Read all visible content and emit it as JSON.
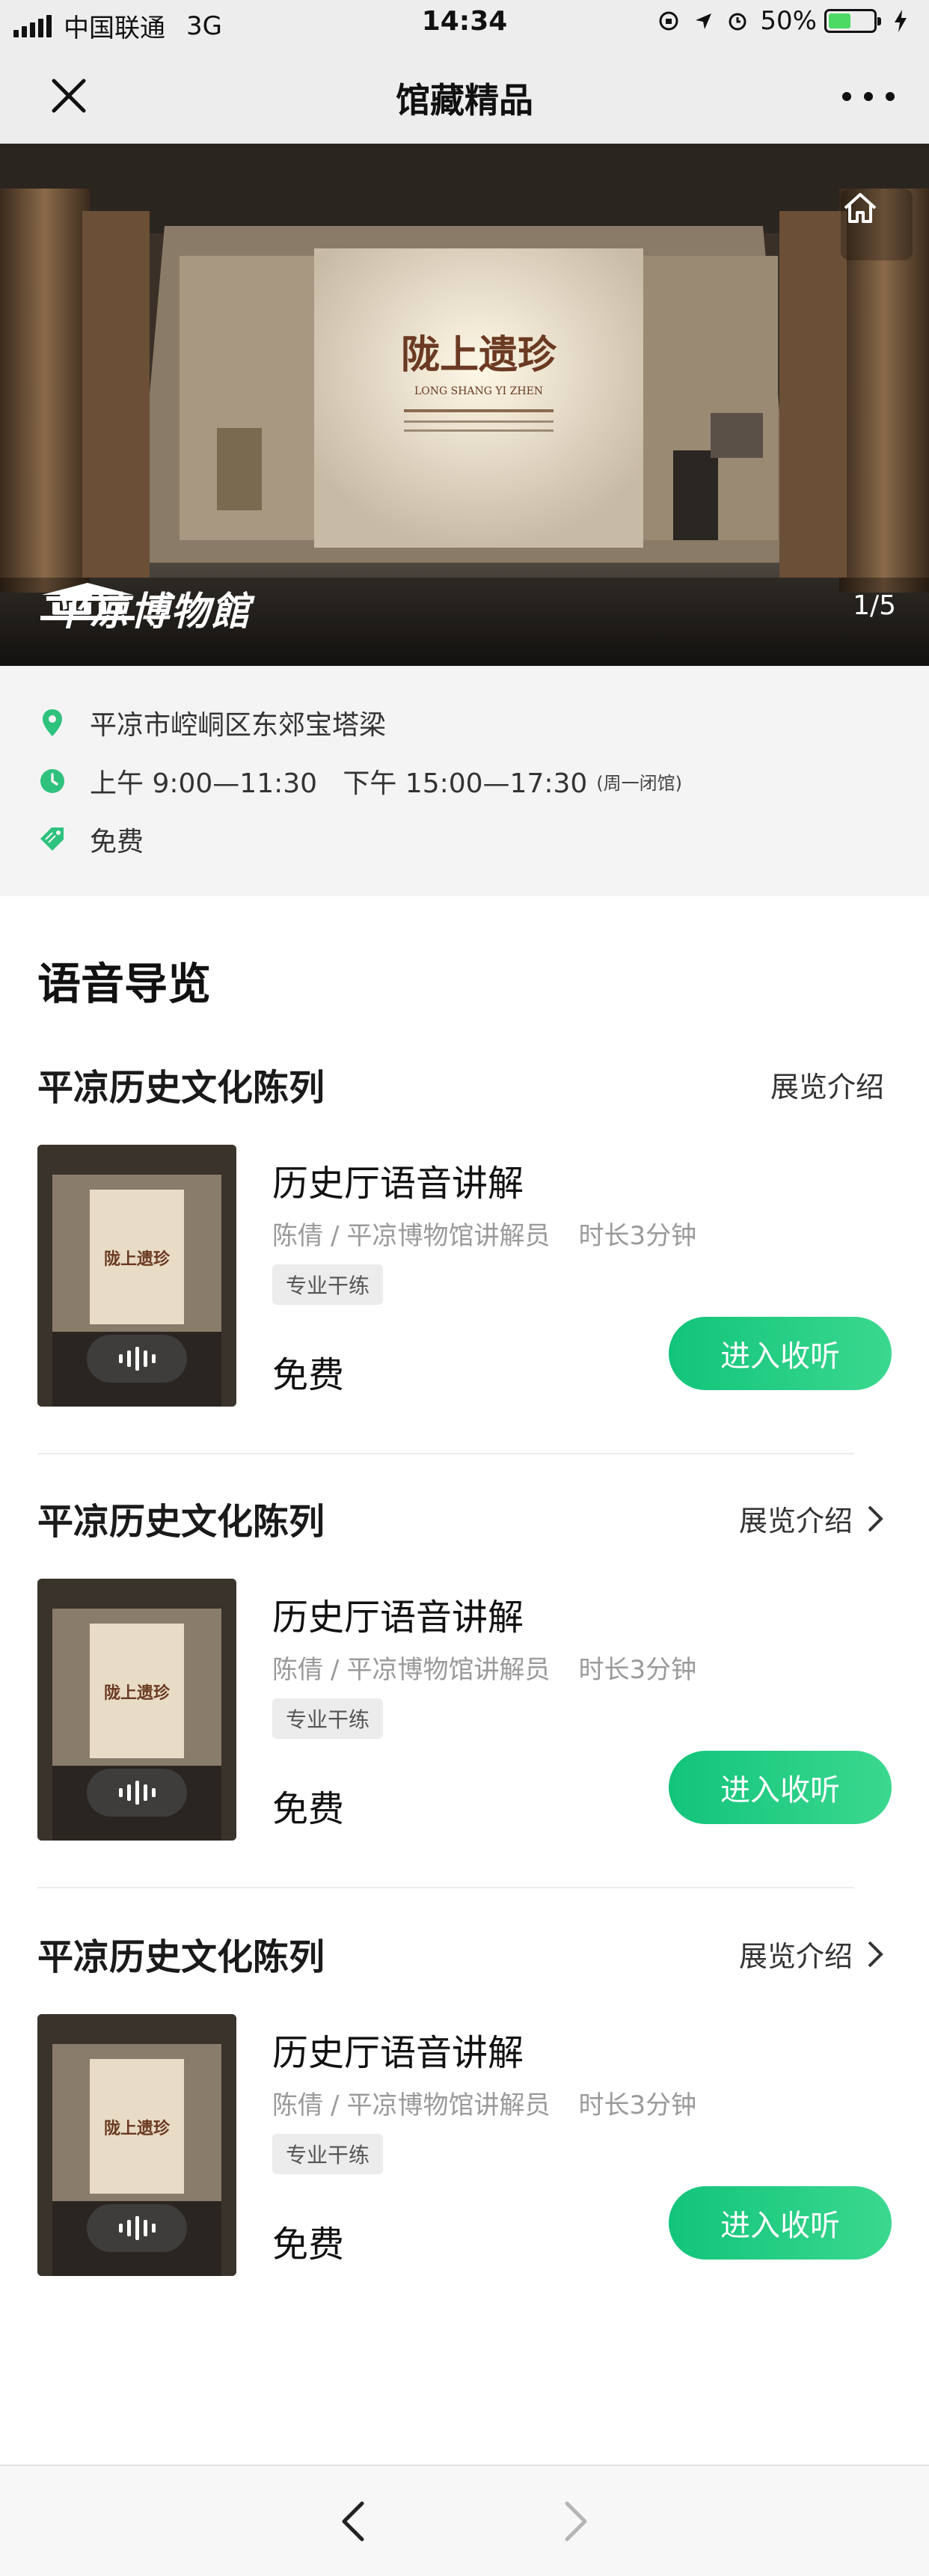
{
  "status_bar": {
    "carrier": "中国联通",
    "network": "3G",
    "time": "14:34",
    "battery": "50%",
    "battery_level": 0.5
  },
  "nav": {
    "title": "馆藏精品"
  },
  "hero": {
    "exhibit_title": "陇上遗珍",
    "exhibit_pinyin": "LONG SHANG YI ZHEN",
    "museum_name": "平凉博物館",
    "page_indicator": "1/5"
  },
  "info": {
    "address": "平凉市崆峒区东郊宝塔梁",
    "hours": "上午 9:00—11:30   下午 15:00—17:30",
    "hours_note": "(周一闭馆)",
    "price": "免费"
  },
  "colors": {
    "accent": "#1ac47b",
    "icon_green": "#2ec27e"
  },
  "section": {
    "title": "语音导览"
  },
  "groups": [
    {
      "title": "平凉历史文化陈列",
      "link_label": "展览介绍",
      "card": {
        "title": "历史厅语音讲解",
        "narrator": "陈倩",
        "separator": "/",
        "role": "平凉博物馆讲解员",
        "duration": "时长3分钟",
        "tag": "专业干练",
        "price": "免费",
        "button": "进入收听"
      }
    },
    {
      "title": "平凉历史文化陈列",
      "link_label": "展览介绍",
      "card": {
        "title": "历史厅语音讲解",
        "narrator": "陈倩",
        "separator": "/",
        "role": "平凉博物馆讲解员",
        "duration": "时长3分钟",
        "tag": "专业干练",
        "price": "免费",
        "button": "进入收听"
      }
    },
    {
      "title": "平凉历史文化陈列",
      "link_label": "展览介绍",
      "card": {
        "title": "历史厅语音讲解",
        "narrator": "陈倩",
        "separator": "/",
        "role": "平凉博物馆讲解员",
        "duration": "时长3分钟",
        "tag": "专业干练",
        "price": "免费",
        "button": "进入收听"
      }
    }
  ]
}
